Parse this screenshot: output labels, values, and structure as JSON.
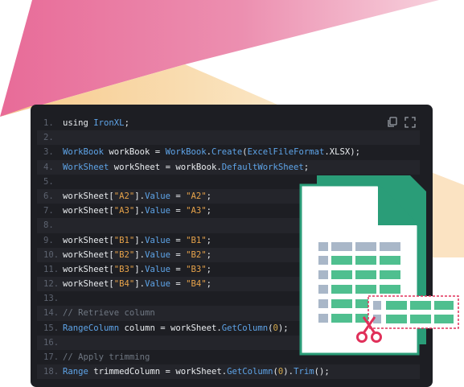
{
  "colors": {
    "panel_bg": "#1d1e23",
    "pink": "#e8759e",
    "yellow": "#f6d59a",
    "teal": "#2a9d78",
    "light_teal": "#b7e1d1",
    "red": "#e0305a"
  },
  "toolbar": {
    "copy_icon": "copy-icon",
    "expand_icon": "fullscreen-icon"
  },
  "code": {
    "lines": [
      {
        "n": "1.",
        "tokens": [
          [
            "kw",
            "using "
          ],
          [
            "type",
            "IronXL"
          ],
          [
            "kw",
            ";"
          ]
        ]
      },
      {
        "n": "2.",
        "tokens": []
      },
      {
        "n": "3.",
        "tokens": [
          [
            "type",
            "WorkBook"
          ],
          [
            "kw",
            " workBook = "
          ],
          [
            "type",
            "WorkBook"
          ],
          [
            "kw",
            "."
          ],
          [
            "prop",
            "Create"
          ],
          [
            "kw",
            "("
          ],
          [
            "type",
            "ExcelFileFormat"
          ],
          [
            "kw",
            ".XLSX);"
          ]
        ]
      },
      {
        "n": "4.",
        "tokens": [
          [
            "type",
            "WorkSheet"
          ],
          [
            "kw",
            " workSheet = workBook."
          ],
          [
            "prop",
            "DefaultWorkSheet"
          ],
          [
            "kw",
            ";"
          ]
        ]
      },
      {
        "n": "5.",
        "tokens": []
      },
      {
        "n": "6.",
        "tokens": [
          [
            "kw",
            "workSheet["
          ],
          [
            "str",
            "\"A2\""
          ],
          [
            "kw",
            "]."
          ],
          [
            "prop",
            "Value"
          ],
          [
            "kw",
            " = "
          ],
          [
            "str",
            "\"A2\""
          ],
          [
            "kw",
            ";"
          ]
        ]
      },
      {
        "n": "7.",
        "tokens": [
          [
            "kw",
            "workSheet["
          ],
          [
            "str",
            "\"A3\""
          ],
          [
            "kw",
            "]."
          ],
          [
            "prop",
            "Value"
          ],
          [
            "kw",
            " = "
          ],
          [
            "str",
            "\"A3\""
          ],
          [
            "kw",
            ";"
          ]
        ]
      },
      {
        "n": "8.",
        "tokens": []
      },
      {
        "n": "9.",
        "tokens": [
          [
            "kw",
            "workSheet["
          ],
          [
            "str",
            "\"B1\""
          ],
          [
            "kw",
            "]."
          ],
          [
            "prop",
            "Value"
          ],
          [
            "kw",
            " = "
          ],
          [
            "str",
            "\"B1\""
          ],
          [
            "kw",
            ";"
          ]
        ]
      },
      {
        "n": "10.",
        "tokens": [
          [
            "kw",
            "workSheet["
          ],
          [
            "str",
            "\"B2\""
          ],
          [
            "kw",
            "]."
          ],
          [
            "prop",
            "Value"
          ],
          [
            "kw",
            " = "
          ],
          [
            "str",
            "\"B2\""
          ],
          [
            "kw",
            ";"
          ]
        ]
      },
      {
        "n": "11.",
        "tokens": [
          [
            "kw",
            "workSheet["
          ],
          [
            "str",
            "\"B3\""
          ],
          [
            "kw",
            "]."
          ],
          [
            "prop",
            "Value"
          ],
          [
            "kw",
            " = "
          ],
          [
            "str",
            "\"B3\""
          ],
          [
            "kw",
            ";"
          ]
        ]
      },
      {
        "n": "12.",
        "tokens": [
          [
            "kw",
            "workSheet["
          ],
          [
            "str",
            "\"B4\""
          ],
          [
            "kw",
            "]."
          ],
          [
            "prop",
            "Value"
          ],
          [
            "kw",
            " = "
          ],
          [
            "str",
            "\"B4\""
          ],
          [
            "kw",
            ";"
          ]
        ]
      },
      {
        "n": "13.",
        "tokens": []
      },
      {
        "n": "14.",
        "tokens": [
          [
            "cm",
            "// Retrieve column"
          ]
        ]
      },
      {
        "n": "15.",
        "tokens": [
          [
            "type",
            "RangeColumn"
          ],
          [
            "kw",
            " column = workSheet."
          ],
          [
            "prop",
            "GetColumn"
          ],
          [
            "kw",
            "("
          ],
          [
            "num-lit",
            "0"
          ],
          [
            "kw",
            ");"
          ]
        ]
      },
      {
        "n": "16.",
        "tokens": []
      },
      {
        "n": "17.",
        "tokens": [
          [
            "cm",
            "// Apply trimming"
          ]
        ]
      },
      {
        "n": "18.",
        "tokens": [
          [
            "type",
            "Range"
          ],
          [
            "kw",
            " trimmedColumn = workSheet."
          ],
          [
            "prop",
            "GetColumn"
          ],
          [
            "kw",
            "("
          ],
          [
            "num-lit",
            "0"
          ],
          [
            "kw",
            ")."
          ],
          [
            "prop",
            "Trim"
          ],
          [
            "kw",
            "();"
          ]
        ]
      }
    ]
  },
  "illustration": {
    "icon": "spreadsheet-trim-icon"
  }
}
